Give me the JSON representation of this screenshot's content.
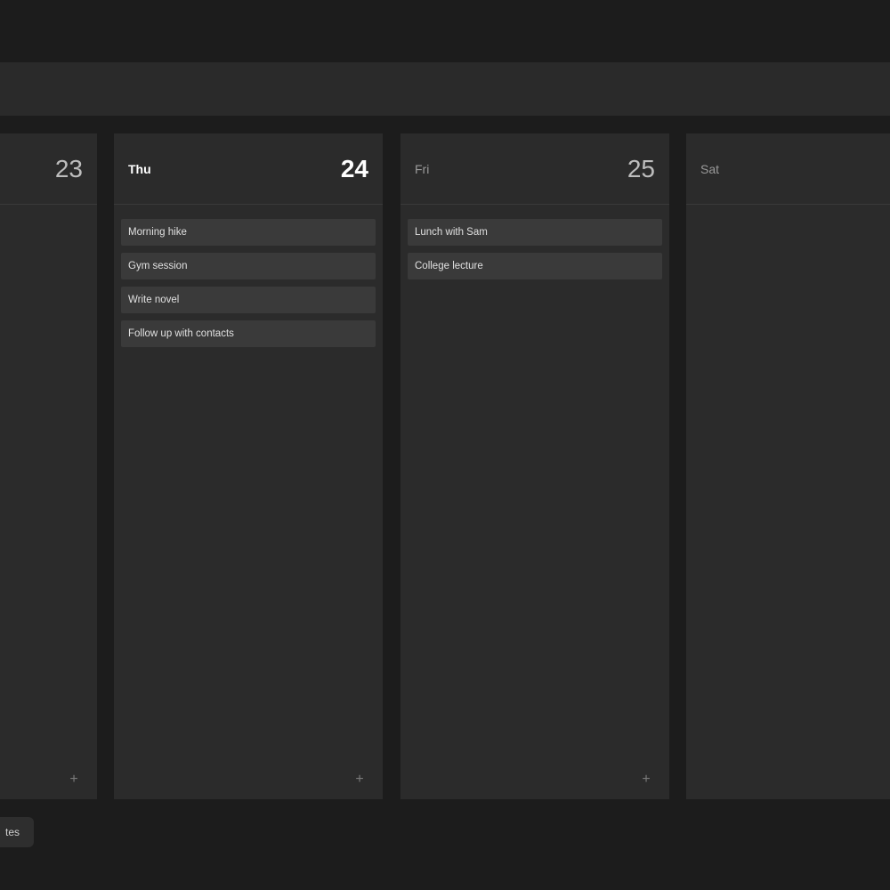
{
  "days": [
    {
      "name": "",
      "number": "23",
      "active": false,
      "events": []
    },
    {
      "name": "Thu",
      "number": "24",
      "active": true,
      "events": [
        "Morning hike",
        "Gym session",
        "Write novel",
        "Follow up with contacts"
      ]
    },
    {
      "name": "Fri",
      "number": "25",
      "active": false,
      "events": [
        "Lunch with Sam",
        "College lecture"
      ]
    },
    {
      "name": "Sat",
      "number": "",
      "active": false,
      "events": []
    }
  ],
  "add_glyph": "+",
  "footer": {
    "notes_label": "tes"
  },
  "colors": {
    "background": "#1c1c1c",
    "column": "#2b2b2b",
    "event": "#3a3a3a",
    "active_text": "#ffffff"
  }
}
